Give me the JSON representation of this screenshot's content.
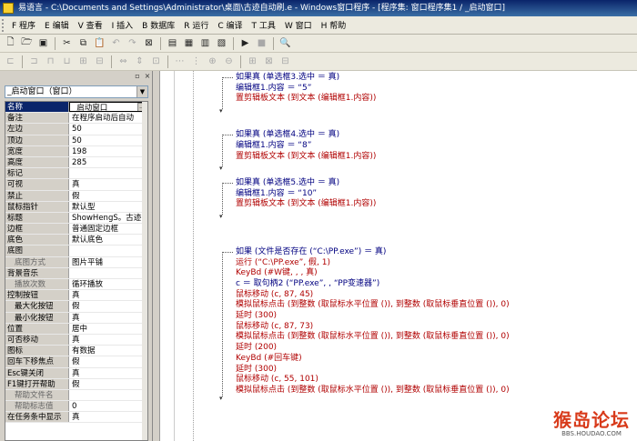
{
  "window": {
    "title": "易语言 - C:\\Documents and Settings\\Administrator\\桌面\\古迹自动刷.e - Windows窗口程序 - [程序集: 窗口程序集1 / _启动窗口]"
  },
  "menu": [
    "F 程序",
    "E 编辑",
    "V 查看",
    "I 插入",
    "B 数据库",
    "R 运行",
    "C 编译",
    "T 工具",
    "W 窗口",
    "H 帮助"
  ],
  "toolbar1": [
    {
      "icon": "new-file-icon",
      "glyph": "🗋"
    },
    {
      "icon": "open-icon",
      "glyph": "🗁"
    },
    {
      "icon": "save-icon",
      "glyph": "▣"
    },
    {
      "icon": "sep"
    },
    {
      "icon": "cut-icon",
      "glyph": "✂"
    },
    {
      "icon": "copy-icon",
      "glyph": "⧉"
    },
    {
      "icon": "paste-icon",
      "glyph": "📋"
    },
    {
      "icon": "undo-icon",
      "glyph": "↶"
    },
    {
      "icon": "redo-icon",
      "glyph": "↷"
    },
    {
      "icon": "delete-icon",
      "glyph": "⊠"
    },
    {
      "icon": "sep"
    },
    {
      "icon": "layout1-icon",
      "glyph": "▤"
    },
    {
      "icon": "layout2-icon",
      "glyph": "▦"
    },
    {
      "icon": "layout3-icon",
      "glyph": "▥"
    },
    {
      "icon": "layout4-icon",
      "glyph": "▧"
    },
    {
      "icon": "sep"
    },
    {
      "icon": "run-icon",
      "glyph": "▶"
    },
    {
      "icon": "stop-icon",
      "glyph": "■"
    },
    {
      "icon": "sep"
    },
    {
      "icon": "binoculars-icon",
      "glyph": "🔍"
    }
  ],
  "toolbar2_icons": [
    "align-left-icon",
    "align-center-icon",
    "align-right-icon",
    "align-top-icon",
    "align-middle-icon",
    "align-bottom-icon",
    "same-width-icon",
    "same-height-icon",
    "same-size-icon",
    "h-space-icon",
    "v-space-icon",
    "center-h-icon",
    "center-v-icon",
    "grid-icon",
    "lock-icon",
    "tab-order-icon"
  ],
  "panel": {
    "close_glyph": "×",
    "pin_glyph": "▫",
    "selected_object": "_启动窗口（窗口）"
  },
  "properties": [
    {
      "name": "名称",
      "value": "_启动窗口",
      "selected": true
    },
    {
      "name": "备注",
      "value": "在程序启动后自动"
    },
    {
      "name": "左边",
      "value": "50"
    },
    {
      "name": "顶边",
      "value": "50"
    },
    {
      "name": "宽度",
      "value": "198"
    },
    {
      "name": "高度",
      "value": "285"
    },
    {
      "name": "标记",
      "value": ""
    },
    {
      "name": "可视",
      "value": "真"
    },
    {
      "name": "禁止",
      "value": "假"
    },
    {
      "name": "鼠标指针",
      "value": "默认型"
    },
    {
      "name": "标题",
      "value": "ShowHengS。古迹扌"
    },
    {
      "name": "边框",
      "value": "普通固定边框"
    },
    {
      "name": "底色",
      "value": "默认底色"
    },
    {
      "name": "底图",
      "value": ""
    },
    {
      "name": "底图方式",
      "value": "图片平铺",
      "indent": true,
      "gray": true
    },
    {
      "name": "背景音乐",
      "value": ""
    },
    {
      "name": "播放次数",
      "value": "循环播放",
      "indent": true,
      "gray": true
    },
    {
      "name": "控制按钮",
      "value": "真"
    },
    {
      "name": "最大化按钮",
      "value": "假",
      "indent": true
    },
    {
      "name": "最小化按钮",
      "value": "真",
      "indent": true
    },
    {
      "name": "位置",
      "value": "居中"
    },
    {
      "name": "可否移动",
      "value": "真"
    },
    {
      "name": "图标",
      "value": "有数据"
    },
    {
      "name": "回车下移焦点",
      "value": "假"
    },
    {
      "name": "Esc键关闭",
      "value": "真"
    },
    {
      "name": "F1键打开帮助",
      "value": "假"
    },
    {
      "name": "帮助文件名",
      "value": "",
      "indent": true,
      "gray": true
    },
    {
      "name": "帮助标志值",
      "value": "0",
      "indent": true,
      "gray": true
    },
    {
      "name": "在任务条中显示",
      "value": "真"
    }
  ],
  "code": [
    {
      "text": "如果真 (单选框3.选中 ＝ 真)",
      "style": "kw",
      "row": 0
    },
    {
      "text": "编辑框1.内容 ＝ “5”",
      "style": "kw",
      "row": 1
    },
    {
      "text": "置剪辑板文本 (到文本 (编辑框1.内容))",
      "style": "red",
      "row": 2
    },
    {
      "text": "如果真 (单选框4.选中 ＝ 真)",
      "style": "kw",
      "row": 5.4
    },
    {
      "text": "编辑框1.内容 ＝ “8”",
      "style": "kw",
      "row": 6.4
    },
    {
      "text": "置剪辑板文本 (到文本 (编辑框1.内容))",
      "style": "red",
      "row": 7.4
    },
    {
      "text": "如果真 (单选框5.选中 ＝ 真)",
      "style": "kw",
      "row": 9.9
    },
    {
      "text": "编辑框1.内容 ＝ “10”",
      "style": "kw",
      "row": 10.9
    },
    {
      "text": "置剪辑板文本 (到文本 (编辑框1.内容))",
      "style": "red",
      "row": 11.9
    },
    {
      "text": "如果 (文件是否存在 (“C:\\PP.exe”) ＝ 真)",
      "style": "kw",
      "row": 16.4
    },
    {
      "text": "运行 (“C:\\PP.exe”, 假, 1)",
      "style": "red",
      "row": 17.4
    },
    {
      "text": "KeyBd (#W键, , , 真)",
      "style": "red",
      "row": 18.4
    },
    {
      "text": "c ＝ 取句柄2 (“PP.exe”, , “PP变速器”)",
      "style": "kw",
      "row": 19.4
    },
    {
      "text": "鼠标移动 (c, 87, 45)",
      "style": "red",
      "row": 20.4
    },
    {
      "text": "模拟鼠标点击 (到整数 (取鼠标水平位置 ()), 到整数 (取鼠标垂直位置 ()), 0)",
      "style": "red",
      "row": 21.4
    },
    {
      "text": "延时 (300)",
      "style": "red",
      "row": 22.4
    },
    {
      "text": "鼠标移动 (c, 87, 73)",
      "style": "red",
      "row": 23.4
    },
    {
      "text": "模拟鼠标点击 (到整数 (取鼠标水平位置 ()), 到整数 (取鼠标垂直位置 ()), 0)",
      "style": "red",
      "row": 24.4
    },
    {
      "text": "延时 (200)",
      "style": "red",
      "row": 25.4
    },
    {
      "text": "KeyBd (#回车键)",
      "style": "red",
      "row": 26.4
    },
    {
      "text": "延时 (300)",
      "style": "red",
      "row": 27.4
    },
    {
      "text": "鼠标移动 (c, 55, 101)",
      "style": "red",
      "row": 28.4
    },
    {
      "text": "模拟鼠标点击 (到整数 (取鼠标水平位置 ()), 到整数 (取鼠标垂直位置 ()), 0)",
      "style": "red",
      "row": 29.4
    }
  ],
  "watermark": {
    "text": "猴岛论坛",
    "url": "BBS.HOUDAO.COM"
  }
}
